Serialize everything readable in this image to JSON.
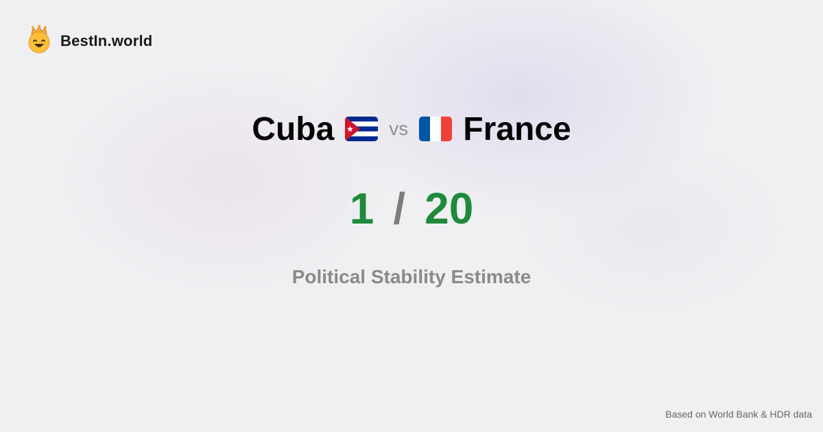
{
  "brand": {
    "name": "BestIn.world",
    "logo_icon": "crowned-smiley-face-icon"
  },
  "comparison": {
    "left_country": "Cuba",
    "left_flag_icon": "cuba-flag-icon",
    "vs_label": "vs",
    "right_country": "France",
    "right_flag_icon": "france-flag-icon"
  },
  "ranks": {
    "left": "1",
    "separator": "/",
    "right": "20"
  },
  "metric": {
    "label": "Political Stability Estimate"
  },
  "footer": {
    "source": "Based on World Bank & HDR data"
  },
  "colors": {
    "rank_green": "#1f8a3b",
    "separator_gray": "#7d7d7f",
    "metric_gray": "#8a8a8c",
    "background": "#f0f0f2",
    "cuba_blue": "#002a8f",
    "cuba_red": "#cf142b",
    "france_blue": "#0055a4",
    "france_red": "#ef4135"
  }
}
